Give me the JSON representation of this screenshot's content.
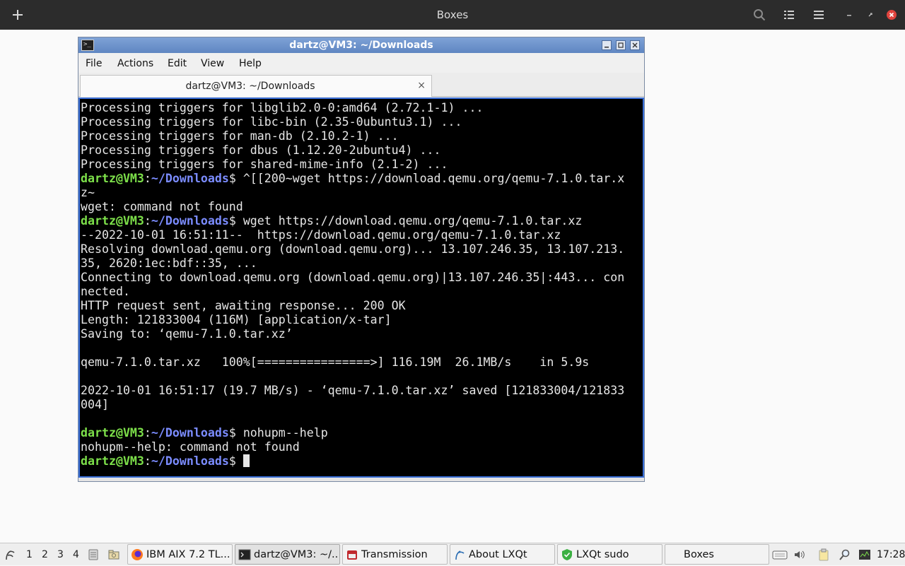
{
  "boxes": {
    "title": "Boxes"
  },
  "terminal": {
    "window_title": "dartz@VM3: ~/Downloads",
    "menu": [
      "File",
      "Actions",
      "Edit",
      "View",
      "Help"
    ],
    "tab_title": "dartz@VM3: ~/Downloads",
    "tab_close": "×",
    "prompt_user": "dartz@VM3",
    "prompt_sep": ":",
    "prompt_path": "~/Downloads",
    "prompt_dollar": "$ ",
    "lines": {
      "l0": "Processing triggers for libglib2.0-0:amd64 (2.72.1-1) ...",
      "l1": "Processing triggers for libc-bin (2.35-0ubuntu3.1) ...",
      "l2": "Processing triggers for man-db (2.10.2-1) ...",
      "l3": "Processing triggers for dbus (1.12.20-2ubuntu4) ...",
      "l4": "Processing triggers for shared-mime-info (2.1-2) ...",
      "cmd1": "^[[200~wget https://download.qemu.org/qemu-7.1.0.tar.x",
      "l6": "z~",
      "l7": "wget: command not found",
      "cmd2": "wget https://download.qemu.org/qemu-7.1.0.tar.xz",
      "l9": "--2022-10-01 16:51:11--  https://download.qemu.org/qemu-7.1.0.tar.xz",
      "l10": "Resolving download.qemu.org (download.qemu.org)... 13.107.246.35, 13.107.213.",
      "l11": "35, 2620:1ec:bdf::35, ...",
      "l12": "Connecting to download.qemu.org (download.qemu.org)|13.107.246.35|:443... con",
      "l13": "nected.",
      "l14": "HTTP request sent, awaiting response... 200 OK",
      "l15": "Length: 121833004 (116M) [application/x-tar]",
      "l16": "Saving to: ‘qemu-7.1.0.tar.xz’",
      "l18": "qemu-7.1.0.tar.xz   100%[================>] 116.19M  26.1MB/s    in 5.9s",
      "l20": "2022-10-01 16:51:17 (19.7 MB/s) - ‘qemu-7.1.0.tar.xz’ saved [121833004/121833",
      "l21": "004]",
      "cmd3": "nohupm--help",
      "l24": "nohupm--help: command not found"
    }
  },
  "taskbar": {
    "workspaces": [
      "1",
      "2",
      "3",
      "4"
    ],
    "tasks": [
      {
        "label": "IBM AIX 7.2 TL..."
      },
      {
        "label": "dartz@VM3: ~/..."
      },
      {
        "label": "Transmission"
      },
      {
        "label": "About LXQt"
      },
      {
        "label": "LXQt sudo"
      },
      {
        "label": "Boxes"
      }
    ],
    "clock": "17:28"
  }
}
